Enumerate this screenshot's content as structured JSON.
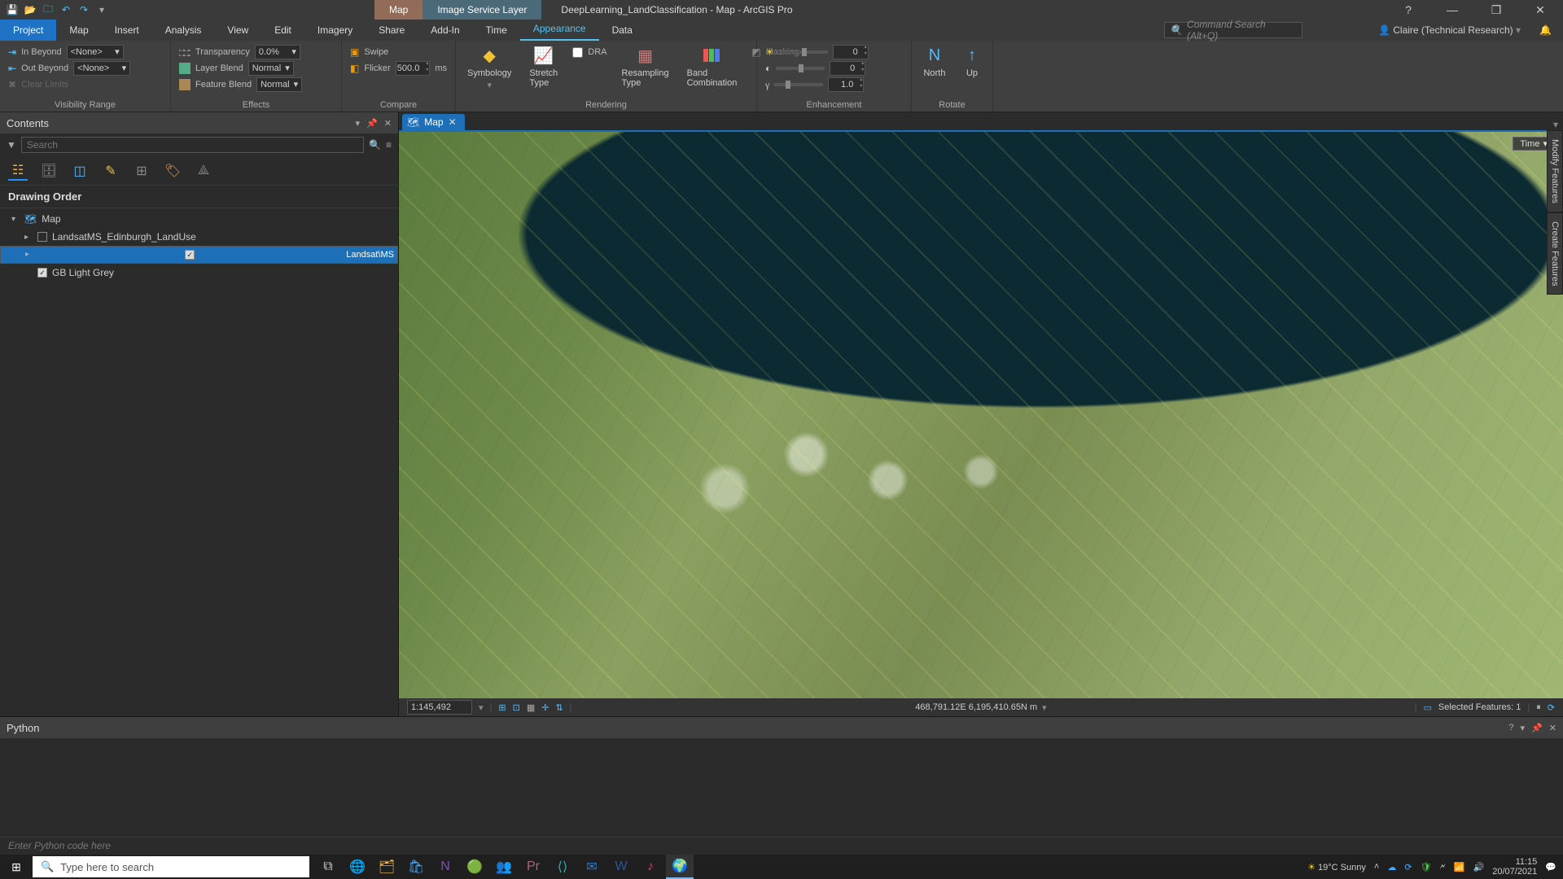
{
  "title_context_tabs": [
    "Map",
    "Image Service Layer"
  ],
  "doc_title": "DeepLearning_LandClassification - Map - ArcGIS Pro",
  "window_controls": {
    "help": "?",
    "min": "—",
    "max": "❐",
    "close": "✕"
  },
  "qat": [
    "save-icon",
    "open-icon",
    "folder-icon",
    "undo-icon",
    "redo-icon",
    "customize-icon"
  ],
  "ribbon_tabs": [
    "Project",
    "Map",
    "Insert",
    "Analysis",
    "View",
    "Edit",
    "Imagery",
    "Share",
    "Add-In",
    "Time",
    "Appearance",
    "Data"
  ],
  "ribbon_active_tab": "Appearance",
  "command_search_placeholder": "Command Search (Alt+Q)",
  "user_name": "Claire (Technical Research)",
  "ribbon": {
    "visibility": {
      "in_label": "In Beyond",
      "out_label": "Out Beyond",
      "clear_label": "Clear Limits",
      "none": "<None>",
      "group": "Visibility Range"
    },
    "effects": {
      "transparency_label": "Transparency",
      "transparency_val": "0.0%",
      "layer_blend_label": "Layer Blend",
      "layer_blend_val": "Normal",
      "feature_blend_label": "Feature Blend",
      "feature_blend_val": "Normal",
      "group": "Effects"
    },
    "compare": {
      "swipe": "Swipe",
      "flicker": "Flicker",
      "flicker_val": "500.0",
      "flicker_unit": "ms",
      "group": "Compare"
    },
    "rendering": {
      "symbology": "Symbology",
      "stretch": "Stretch Type",
      "dra": "DRA",
      "resampling": "Resampling Type",
      "band": "Band Combination",
      "masking": "Masking",
      "group": "Rendering"
    },
    "enhancement": {
      "brightness": "0",
      "contrast": "0",
      "gamma": "1.0",
      "group": "Enhancement"
    },
    "rotate": {
      "north": "North",
      "up": "Up",
      "group": "Rotate"
    }
  },
  "contents": {
    "title": "Contents",
    "search_placeholder": "Search",
    "section": "Drawing Order",
    "tree": {
      "map": "Map",
      "layer1": "LandsatMS_Edinburgh_LandUse",
      "layer2": "Landsat\\MS",
      "layer3": "GB Light Grey"
    }
  },
  "map_tab": "Map",
  "time_overlay": "Time",
  "side_tabs": [
    "Modify Features",
    "Create Features"
  ],
  "map_status": {
    "scale": "1:145,492",
    "coords": "468,791.12E 6,195,410.65N m",
    "selected": "Selected Features: 1"
  },
  "python_title": "Python",
  "python_placeholder": "Enter Python code here",
  "taskbar": {
    "search_placeholder": "Type here to search",
    "weather": "19°C  Sunny",
    "time": "11:15",
    "date": "20/07/2021"
  }
}
